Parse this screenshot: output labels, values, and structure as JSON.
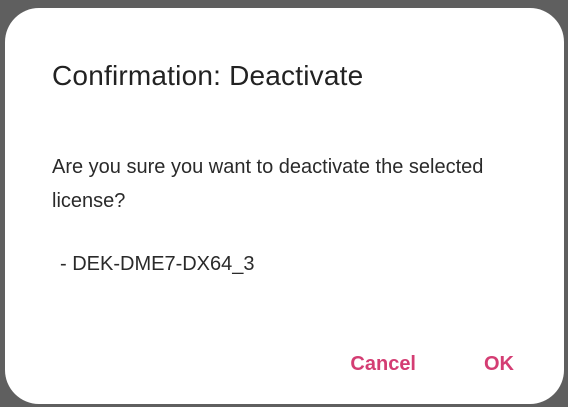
{
  "dialog": {
    "title": "Confirmation: Deactivate",
    "message": "Are you sure you want to deactivate the selected license?",
    "license_item": "- DEK-DME7-DX64_3",
    "cancel_label": "Cancel",
    "ok_label": "OK"
  },
  "colors": {
    "backdrop": "#5f5f5f",
    "dialog_background": "#ffffff",
    "accent": "#d43d73",
    "text": "#222222"
  }
}
